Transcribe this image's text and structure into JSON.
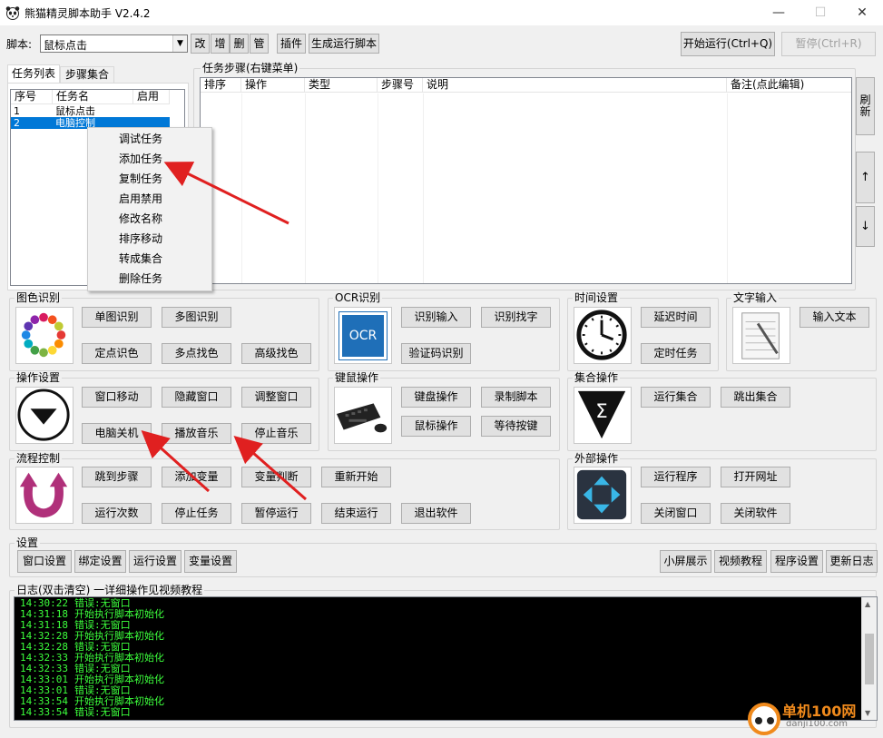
{
  "window": {
    "title": "熊猫精灵脚本助手  V2.4.2",
    "min": "—",
    "max": "☐",
    "close": "✕"
  },
  "toolbar": {
    "script_label": "脚本:",
    "script_value": "鼠标点击",
    "btn_edit": "改",
    "btn_add": "增",
    "btn_delete": "删",
    "btn_manage": "管",
    "btn_plugin": "插件",
    "btn_generate": "生成运行脚本",
    "btn_start": "开始运行(Ctrl+Q)",
    "btn_pause": "暂停(Ctrl+R)"
  },
  "left_tabs": [
    "任务列表",
    "步骤集合"
  ],
  "task_list": {
    "columns": [
      "序号",
      "任务名",
      "启用"
    ],
    "rows": [
      {
        "no": "1",
        "name": "鼠标点击",
        "enabled": ""
      },
      {
        "no": "2",
        "name": "电脑控制",
        "enabled": ""
      }
    ]
  },
  "context_menu": [
    "调试任务",
    "添加任务",
    "复制任务",
    "启用禁用",
    "修改名称",
    "排序移动",
    "转成集合",
    "删除任务"
  ],
  "steps": {
    "label": "任务步骤(右键菜单)",
    "columns": [
      "排序",
      "操作",
      "类型",
      "步骤号",
      "说明",
      "备注(点此编辑)"
    ],
    "refresh": "刷新",
    "up": "↑",
    "down": "↓"
  },
  "sections": {
    "image_color": {
      "label": "图色识别",
      "buttons": [
        "单图识别",
        "多图识别",
        "定点识色",
        "多点找色",
        "高级找色"
      ]
    },
    "ocr": {
      "label": "OCR识别",
      "icon_text": "OCR",
      "buttons": [
        "识别输入",
        "识别找字",
        "验证码识别"
      ]
    },
    "time": {
      "label": "时间设置",
      "buttons": [
        "延迟时间",
        "定时任务"
      ]
    },
    "text_input": {
      "label": "文字输入",
      "buttons": [
        "输入文本"
      ]
    },
    "operation": {
      "label": "操作设置",
      "buttons": [
        "窗口移动",
        "隐藏窗口",
        "调整窗口",
        "电脑关机",
        "播放音乐",
        "停止音乐"
      ]
    },
    "keymouse": {
      "label": "键鼠操作",
      "buttons": [
        "键盘操作",
        "录制脚本",
        "鼠标操作",
        "等待按键"
      ]
    },
    "collection": {
      "label": "集合操作",
      "buttons": [
        "运行集合",
        "跳出集合"
      ]
    },
    "flow": {
      "label": "流程控制",
      "buttons": [
        "跳到步骤",
        "添加变量",
        "变量判断",
        "重新开始",
        "运行次数",
        "停止任务",
        "暂停运行",
        "结束运行",
        "退出软件"
      ]
    },
    "external": {
      "label": "外部操作",
      "buttons": [
        "运行程序",
        "打开网址",
        "关闭窗口",
        "关闭软件"
      ]
    },
    "settings": {
      "label": "设置",
      "left_buttons": [
        "窗口设置",
        "绑定设置",
        "运行设置",
        "变量设置"
      ],
      "right_buttons": [
        "小屏展示",
        "视频教程",
        "程序设置",
        "更新日志"
      ]
    }
  },
  "log": {
    "label": "日志(双击清空)  一详细操作见视频教程",
    "lines": [
      {
        "time": "14:30:22",
        "msg": "错误:无窗口"
      },
      {
        "time": "14:31:18",
        "msg": "开始执行脚本初始化"
      },
      {
        "time": "14:31:18",
        "msg": "错误:无窗口"
      },
      {
        "time": "14:32:28",
        "msg": "开始执行脚本初始化"
      },
      {
        "time": "14:32:28",
        "msg": "错误:无窗口"
      },
      {
        "time": "14:32:33",
        "msg": "开始执行脚本初始化"
      },
      {
        "time": "14:32:33",
        "msg": "错误:无窗口"
      },
      {
        "time": "14:33:01",
        "msg": "开始执行脚本初始化"
      },
      {
        "time": "14:33:01",
        "msg": "错误:无窗口"
      },
      {
        "time": "14:33:54",
        "msg": "开始执行脚本初始化"
      },
      {
        "time": "14:33:54",
        "msg": "错误:无窗口"
      }
    ]
  },
  "watermark": {
    "brand": "单机100网",
    "url": "danji100.com"
  },
  "colors": {
    "accent": "#0078d7",
    "log_text": "#3cff3c",
    "arrow": "#e02020"
  }
}
